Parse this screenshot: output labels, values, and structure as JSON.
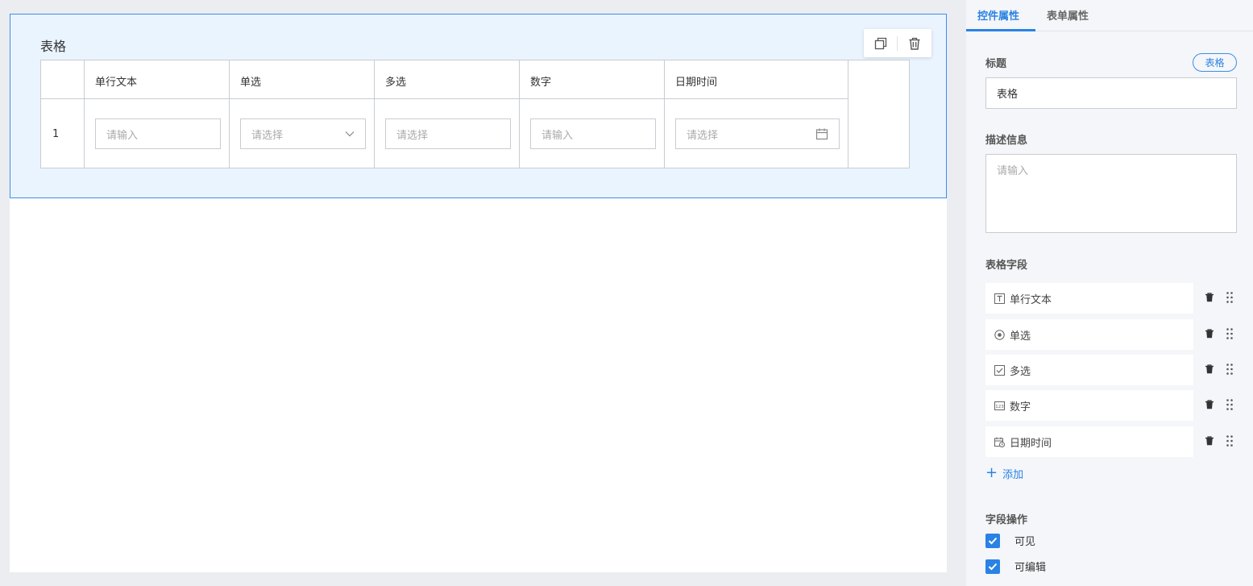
{
  "canvas": {
    "widget_title": "表格",
    "columns": [
      {
        "header": "单行文本",
        "placeholder": "请输入"
      },
      {
        "header": "单选",
        "placeholder": "请选择"
      },
      {
        "header": "多选",
        "placeholder": "请选择"
      },
      {
        "header": "数字",
        "placeholder": "请输入"
      },
      {
        "header": "日期时间",
        "placeholder": "请选择"
      }
    ],
    "row_number": "1"
  },
  "panel": {
    "tabs": [
      {
        "label": "控件属性",
        "active": true
      },
      {
        "label": "表单属性",
        "active": false
      }
    ],
    "title_label": "标题",
    "type_badge": "表格",
    "title_value": "表格",
    "description_label": "描述信息",
    "description_placeholder": "请输入",
    "fields_label": "表格字段",
    "fields": [
      {
        "label": "单行文本",
        "icon": "text-icon"
      },
      {
        "label": "单选",
        "icon": "radio-icon"
      },
      {
        "label": "多选",
        "icon": "checkbox-icon"
      },
      {
        "label": "数字",
        "icon": "number-icon"
      },
      {
        "label": "日期时间",
        "icon": "datetime-icon"
      }
    ],
    "add_label": "添加",
    "operations_label": "字段操作",
    "operations": [
      {
        "label": "可见",
        "checked": true
      },
      {
        "label": "可编辑",
        "checked": true
      }
    ]
  },
  "colors": {
    "accent": "#2a82e4",
    "selected_bg": "#eaf4fe",
    "panel_bg": "#f4f6f9",
    "border": "#c8cdd3"
  }
}
